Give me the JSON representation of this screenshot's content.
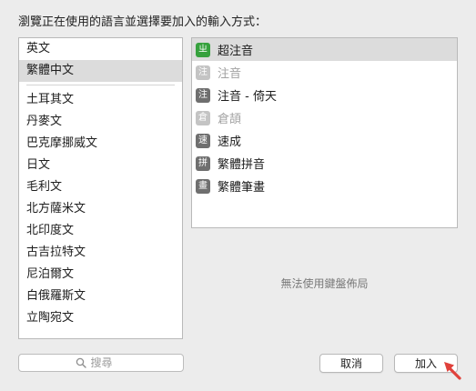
{
  "prompt": "瀏覽正在使用的語言並選擇要加入的輸入方式：",
  "languages": {
    "top": [
      {
        "label": "英文",
        "selected": false
      },
      {
        "label": "繁體中文",
        "selected": true
      }
    ],
    "others": [
      {
        "label": "土耳其文"
      },
      {
        "label": "丹麥文"
      },
      {
        "label": "巴克摩挪威文"
      },
      {
        "label": "日文"
      },
      {
        "label": "毛利文"
      },
      {
        "label": "北方薩米文"
      },
      {
        "label": "北印度文"
      },
      {
        "label": "古吉拉特文"
      },
      {
        "label": "尼泊爾文"
      },
      {
        "label": "白俄羅斯文"
      },
      {
        "label": "立陶宛文"
      }
    ]
  },
  "methods": [
    {
      "icon_char": "ㄓ",
      "icon_name": "bopomofo-green-icon",
      "icon_style": "green",
      "label": "超注音",
      "selected": true,
      "disabled": false
    },
    {
      "icon_char": "注",
      "icon_name": "zhuyin-icon",
      "icon_style": "faded",
      "label": "注音",
      "selected": false,
      "disabled": true
    },
    {
      "icon_char": "注",
      "icon_name": "zhuyin-eten-icon",
      "icon_style": "normal",
      "label": "注音 - 倚天",
      "selected": false,
      "disabled": false
    },
    {
      "icon_char": "倉",
      "icon_name": "cangjie-icon",
      "icon_style": "faded",
      "label": "倉頡",
      "selected": false,
      "disabled": true
    },
    {
      "icon_char": "速",
      "icon_name": "sucheng-icon",
      "icon_style": "normal",
      "label": "速成",
      "selected": false,
      "disabled": false
    },
    {
      "icon_char": "拼",
      "icon_name": "pinyin-icon",
      "icon_style": "normal",
      "label": "繁體拼音",
      "selected": false,
      "disabled": false
    },
    {
      "icon_char": "畫",
      "icon_name": "stroke-icon",
      "icon_style": "normal",
      "label": "繁體筆畫",
      "selected": false,
      "disabled": false
    }
  ],
  "layout_note": "無法使用鍵盤佈局",
  "search": {
    "placeholder": "搜尋"
  },
  "buttons": {
    "cancel": "取消",
    "add": "加入"
  },
  "colors": {
    "accent_green": "#36a13d",
    "cursor_red": "#e0413b"
  }
}
